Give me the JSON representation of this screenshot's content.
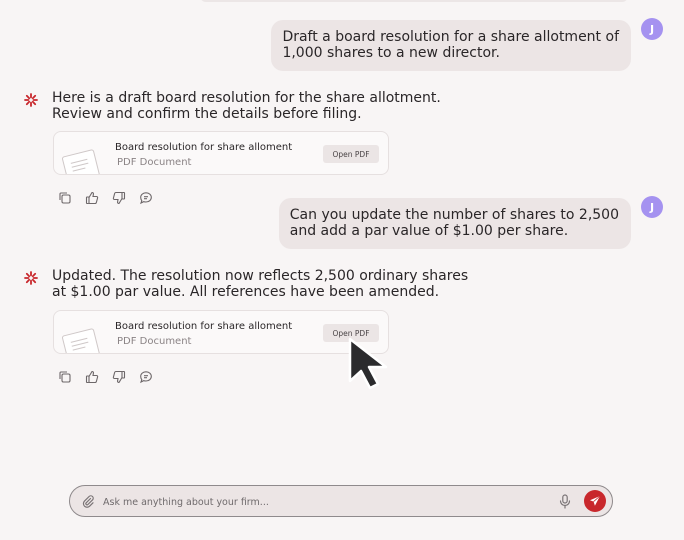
{
  "conversation": {
    "user_initial": "J",
    "message_1_user": "Draft a board resolution for a share allotment of\n1,000 shares to a new director.",
    "message_2_bot": "Here is a draft board resolution for the share allotment.\nReview and confirm the details before filing.",
    "attachment_1": {
      "title": "Board resolution for share alloment",
      "type": "PDF Document",
      "button": "Open PDF"
    },
    "message_3_user": "Can you update the number of shares to 2,500\nand add a par value of $1.00 per share.",
    "message_4_bot": "Updated. The resolution now reflects 2,500 ordinary shares\nat $1.00 par value. All references have been amended.",
    "attachment_2": {
      "title": "Board resolution for share alloment",
      "type": "PDF Document",
      "button": "Open PDF"
    }
  },
  "composer": {
    "placeholder": "Ask me anything about your firm..."
  },
  "icons": {
    "bot": "starburst-logo-icon",
    "attach": "paperclip-icon",
    "mic": "microphone-icon",
    "send": "send-icon",
    "actions": [
      "copy-icon",
      "thumbs-up-icon",
      "thumbs-down-icon",
      "comment-icon"
    ]
  },
  "colors": {
    "accent": "#c8272c",
    "avatar": "#a592f0",
    "background": "#f8f5f5",
    "user_bubble": "#ece5e5"
  }
}
